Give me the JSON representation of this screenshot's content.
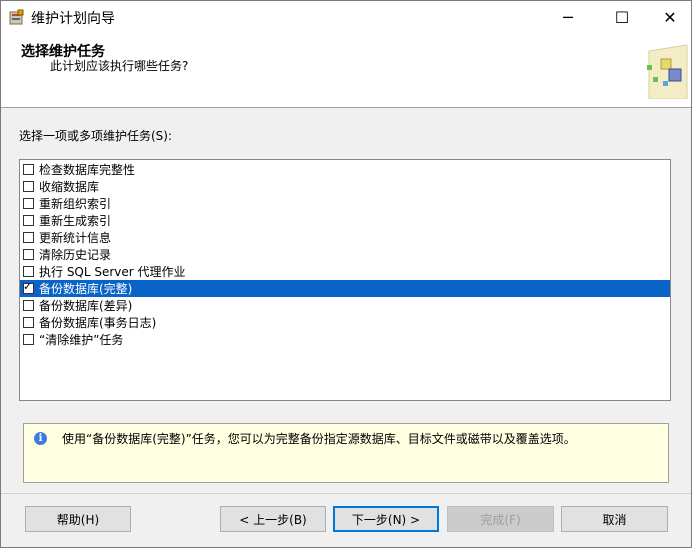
{
  "window": {
    "title": "维护计划向导"
  },
  "header": {
    "title": "选择维护任务",
    "subtitle": "此计划应该执行哪些任务?"
  },
  "prompt": "选择一项或多项维护任务(S):",
  "tasks": [
    {
      "label": "检查数据库完整性",
      "checked": false,
      "selected": false
    },
    {
      "label": "收缩数据库",
      "checked": false,
      "selected": false
    },
    {
      "label": "重新组织索引",
      "checked": false,
      "selected": false
    },
    {
      "label": "重新生成索引",
      "checked": false,
      "selected": false
    },
    {
      "label": "更新统计信息",
      "checked": false,
      "selected": false
    },
    {
      "label": "清除历史记录",
      "checked": false,
      "selected": false
    },
    {
      "label": "执行 SQL Server 代理作业",
      "checked": false,
      "selected": false
    },
    {
      "label": "备份数据库(完整)",
      "checked": true,
      "selected": true
    },
    {
      "label": "备份数据库(差异)",
      "checked": false,
      "selected": false
    },
    {
      "label": "备份数据库(事务日志)",
      "checked": false,
      "selected": false
    },
    {
      "label": "“清除维护”任务",
      "checked": false,
      "selected": false
    }
  ],
  "description": "使用“备份数据库(完整)”任务，您可以为完整备份指定源数据库、目标文件或磁带以及覆盖选项。",
  "buttons": {
    "help": "帮助(H)",
    "back": "< 上一步(B)",
    "next": "下一步(N) >",
    "finish": "完成(F)",
    "cancel": "取消"
  },
  "titlebar_buttons": {
    "minimize": "─",
    "maximize": "☐",
    "close": "✕"
  },
  "colors": {
    "selection": "#0a64c8",
    "info_background": "#ffffe1",
    "primary_border": "#0078d7"
  }
}
